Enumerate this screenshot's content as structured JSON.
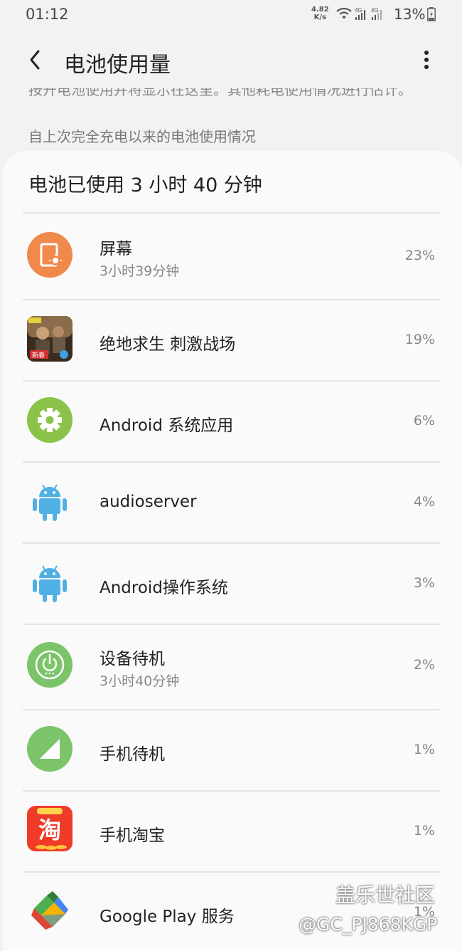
{
  "status_bar": {
    "time": "01:12",
    "net_speed_value": "4.82",
    "net_speed_unit": "K/s",
    "battery_text": "13%",
    "icons": [
      "wifi-icon",
      "signal-4g-icon",
      "signal-4g-icon",
      "battery-charging-icon"
    ]
  },
  "app_bar": {
    "title": "电池使用量",
    "back_icon": "back-arrow-icon",
    "more_icon": "more-vert-icon"
  },
  "clipped_info": "按开电池使用并将显示在这里。其他耗电使用情况进行估计。",
  "section_header": "自上次完全充电以来的电池使用情况",
  "summary": "电池已使用 3 小时 40 分钟",
  "items": [
    {
      "name": "屏幕",
      "sub": "3小时39分钟",
      "percent": "23%",
      "icon": "screen-brightness-icon"
    },
    {
      "name": "绝地求生 刺激战场",
      "sub": "",
      "percent": "19%",
      "icon": "pubg-app-icon"
    },
    {
      "name": "Android 系统应用",
      "sub": "",
      "percent": "6%",
      "icon": "gear-icon"
    },
    {
      "name": "audioserver",
      "sub": "",
      "percent": "4%",
      "icon": "android-robot-icon"
    },
    {
      "name": "Android操作系统",
      "sub": "",
      "percent": "3%",
      "icon": "android-robot-icon"
    },
    {
      "name": "设备待机",
      "sub": "3小时40分钟",
      "percent": "2%",
      "icon": "power-standby-icon"
    },
    {
      "name": "手机待机",
      "sub": "",
      "percent": "1%",
      "icon": "cell-signal-icon"
    },
    {
      "name": "手机淘宝",
      "sub": "",
      "percent": "1%",
      "icon": "taobao-app-icon"
    },
    {
      "name": "Google Play 服务",
      "sub": "",
      "percent": "1%",
      "icon": "play-services-icon"
    }
  ],
  "colors": {
    "screen_icon": "#f0894c",
    "system_green": "#8bc34a",
    "android_blue": "#4fb0e6",
    "standby_green": "#7cc46a",
    "taobao_red": "#f03b28"
  },
  "watermark": {
    "line1": "盖乐世社区",
    "line2": "@GC_PJ868KGP"
  }
}
